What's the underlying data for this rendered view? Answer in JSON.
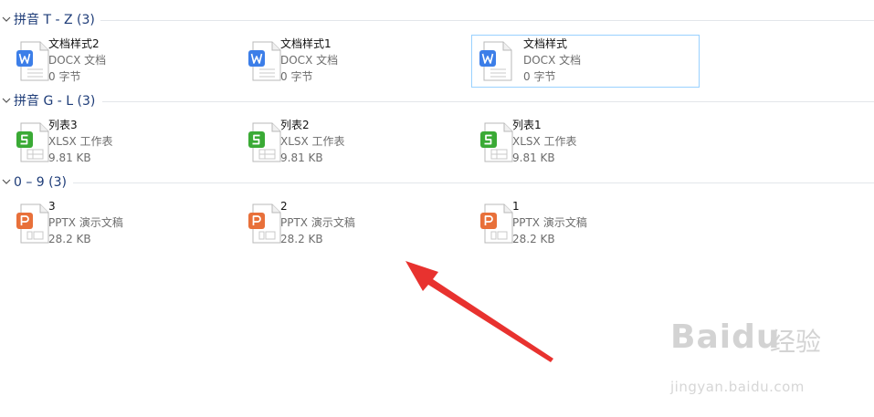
{
  "groups": [
    {
      "title": "拼音 T - Z (3)",
      "items": [
        {
          "name": "文档样式2",
          "type": "DOCX 文档",
          "size": "0 字节",
          "icon": "word-doc-icon"
        },
        {
          "name": "文档样式1",
          "type": "DOCX 文档",
          "size": "0 字节",
          "icon": "word-doc-icon"
        },
        {
          "name": "文档样式",
          "type": "DOCX 文档",
          "size": "0 字节",
          "icon": "word-doc-icon",
          "selected": true
        }
      ]
    },
    {
      "title": "拼音 G - L (3)",
      "items": [
        {
          "name": "列表3",
          "type": "XLSX 工作表",
          "size": "9.81 KB",
          "icon": "excel-sheet-icon"
        },
        {
          "name": "列表2",
          "type": "XLSX 工作表",
          "size": "9.81 KB",
          "icon": "excel-sheet-icon"
        },
        {
          "name": "列表1",
          "type": "XLSX 工作表",
          "size": "9.81 KB",
          "icon": "excel-sheet-icon"
        }
      ]
    },
    {
      "title": "0 – 9 (3)",
      "items": [
        {
          "name": "3",
          "type": "PPTX 演示文稿",
          "size": "28.2 KB",
          "icon": "ppt-presentation-icon"
        },
        {
          "name": "2",
          "type": "PPTX 演示文稿",
          "size": "28.2 KB",
          "icon": "ppt-presentation-icon"
        },
        {
          "name": "1",
          "type": "PPTX 演示文稿",
          "size": "28.2 KB",
          "icon": "ppt-presentation-icon"
        }
      ]
    }
  ],
  "icon_colors": {
    "word": "#3c7ee8",
    "excel": "#3aaa35",
    "ppt": "#e8703a"
  },
  "annotation": {
    "arrow_color": "#e8322f"
  },
  "watermark": {
    "main": "Bai",
    "brand": "du",
    "cn": "经验",
    "url": "jingyan.baidu.com"
  }
}
